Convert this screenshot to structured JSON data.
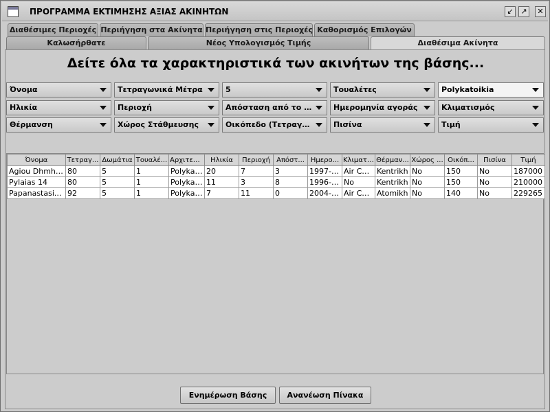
{
  "window": {
    "title": "ΠΡΟΓΡΑΜΜΑ ΕΚΤΙΜΗΣΗΣ ΑΞΙΑΣ ΑΚΙΝΗΤΩΝ"
  },
  "tabs_top": [
    "Διαθέσιμες Περιοχές",
    "Περιήγηση στα Ακίνητα",
    "Περιήγηση στις Περιοχές",
    "Καθορισμός Επιλογών"
  ],
  "tabs_bottom": [
    "Καλωσήρθατε",
    "Νέος Υπολογισμός Τιμής",
    "Διαθέσιμα Ακίνητα"
  ],
  "active_tab": "Διαθέσιμα Ακίνητα",
  "heading": "Δείτε όλα τα χαρακτηριστικά των ακινήτων της βάσης...",
  "combos": [
    [
      "Όνομα",
      "Τετραγωνικά Μέτρα",
      "5",
      "Τουαλέτες",
      "Polykatoikia"
    ],
    [
      "Ηλικία",
      "Περιοχή",
      "Απόσταση από το Κέ...",
      "Ημερομηνία αγοράς",
      "Κλιματισμός"
    ],
    [
      "Θέρμανση",
      "Χώρος Στάθμευσης",
      "Οικόπεδο (Τετραγων...",
      "Πισίνα",
      "Τιμή"
    ]
  ],
  "table": {
    "headers": [
      "Όνομα",
      "Τετραγ...",
      "Δωμάτια",
      "Τουαλέ...",
      "Αρχιτεκ...",
      "Ηλικία",
      "Περιοχή",
      "Απόστ...",
      "Ημερο...",
      "Κλιματι...",
      "Θέρμαν...",
      "Χώρος ...",
      "Οικόπ...",
      "Πισίνα",
      "Τιμή"
    ],
    "rows": [
      [
        "Agiou Dhmht...",
        "80",
        "5",
        "1",
        "Polykat...",
        "20",
        "7",
        "3",
        "1997-0...",
        "Air Co...",
        "Kentrikh",
        "No",
        "150",
        "No",
        "187000"
      ],
      [
        "Pylaias 14",
        "80",
        "5",
        "1",
        "Polykat...",
        "11",
        "3",
        "8",
        "1996-0...",
        "No",
        "Kentrikh",
        "No",
        "150",
        "No",
        "210000"
      ],
      [
        "Papanastasi...",
        "92",
        "5",
        "1",
        "Polykat...",
        "7",
        "11",
        "0",
        "2004-0...",
        "Air Co...",
        "Atomikh",
        "No",
        "140",
        "No",
        "229265"
      ]
    ]
  },
  "buttons": {
    "update_db": "Ενημέρωση Βάσης",
    "refresh_table": "Ανανέωση Πίνακα"
  }
}
